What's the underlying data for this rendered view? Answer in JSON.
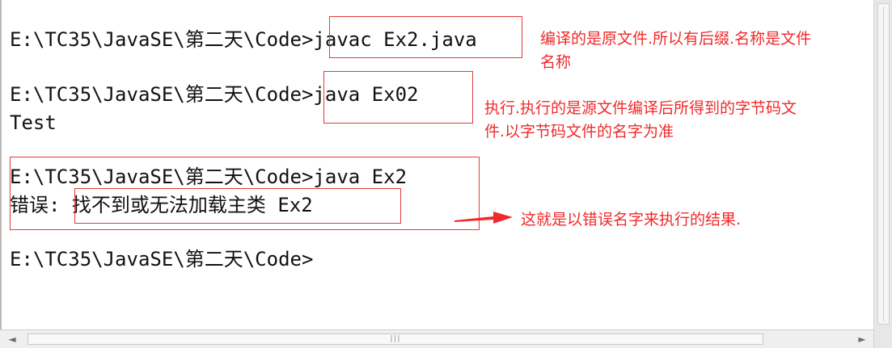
{
  "console": {
    "lines": [
      "E:\\TC35\\JavaSE\\第二天\\Code>javac Ex2.java",
      "E:\\TC35\\JavaSE\\第二天\\Code>java Ex02",
      "Test",
      "E:\\TC35\\JavaSE\\第二天\\Code>java Ex2",
      "错误: 找不到或无法加载主类 Ex2",
      "E:\\TC35\\JavaSE\\第二天\\Code>"
    ]
  },
  "annotations": {
    "compile_note": "编译的是原文件.所以有后缀.名称是文件\n名称",
    "run_note": "执行.执行的是源文件编译后所得到的字节码文\n件.以字节码文件的名字为准",
    "error_note": "这就是以错误名字来执行的结果."
  },
  "colors": {
    "annotation": "#ef2a2a",
    "console_text": "#111111",
    "background": "#ffffff"
  },
  "scrollbar": {
    "left_arrow": "◄",
    "right_arrow": "►",
    "grip": "|||"
  }
}
